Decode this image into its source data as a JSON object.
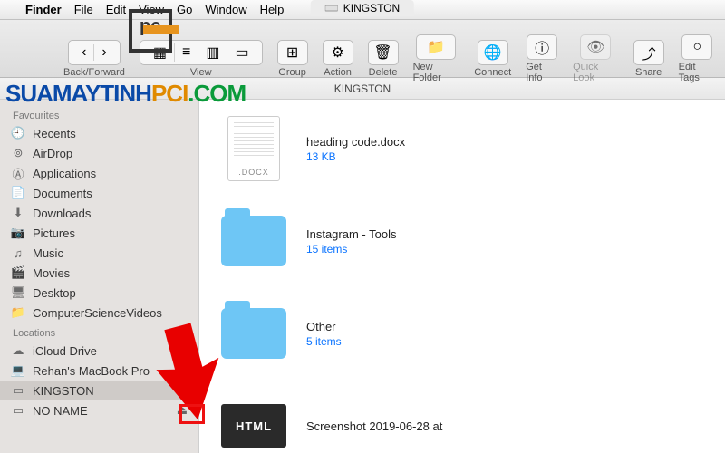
{
  "menubar": {
    "apple": "",
    "app": "Finder",
    "items": [
      "File",
      "Edit",
      "View",
      "Go",
      "Window",
      "Help"
    ]
  },
  "window": {
    "title": "KINGSTON",
    "pathbar": "KINGSTON"
  },
  "toolbar": {
    "back_forward": "Back/Forward",
    "view": "View",
    "group": "Group",
    "action": "Action",
    "delete": "Delete",
    "new_folder": "New Folder",
    "connect": "Connect",
    "get_info": "Get Info",
    "quick_look": "Quick Look",
    "share": "Share",
    "edit_tags": "Edit Tags"
  },
  "sidebar": {
    "favourites_header": "Favourites",
    "favourites": [
      {
        "icon": "clock",
        "label": "Recents"
      },
      {
        "icon": "airdrop",
        "label": "AirDrop"
      },
      {
        "icon": "apps",
        "label": "Applications"
      },
      {
        "icon": "doc",
        "label": "Documents"
      },
      {
        "icon": "download",
        "label": "Downloads"
      },
      {
        "icon": "pictures",
        "label": "Pictures"
      },
      {
        "icon": "music",
        "label": "Music"
      },
      {
        "icon": "movies",
        "label": "Movies"
      },
      {
        "icon": "desktop",
        "label": "Desktop"
      },
      {
        "icon": "folder",
        "label": "ComputerScienceVideos"
      }
    ],
    "locations_header": "Locations",
    "locations": [
      {
        "icon": "icloud",
        "label": "iCloud Drive",
        "eject": false,
        "selected": false
      },
      {
        "icon": "laptop",
        "label": "Rehan's MacBook Pro",
        "eject": false,
        "selected": false
      },
      {
        "icon": "drive",
        "label": "KINGSTON",
        "eject": true,
        "selected": true
      },
      {
        "icon": "drive",
        "label": "NO NAME",
        "eject": true,
        "selected": false
      }
    ]
  },
  "files": [
    {
      "thumb": "docx",
      "thumb_label": ".DOCX",
      "name": "heading code.docx",
      "meta": "13 KB"
    },
    {
      "thumb": "folder",
      "thumb_label": "",
      "name": "Instagram - Tools",
      "meta": "15 items"
    },
    {
      "thumb": "folder",
      "thumb_label": "",
      "name": "Other",
      "meta": "5 items"
    },
    {
      "thumb": "html",
      "thumb_label": "HTML",
      "name": "Screenshot 2019-06-28 at",
      "meta": ""
    }
  ],
  "watermark": {
    "part1": "SUAMAYTINH",
    "part2": "PCI",
    "part3": ".COM"
  }
}
